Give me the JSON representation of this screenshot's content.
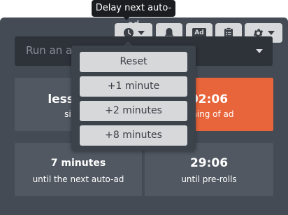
{
  "tooltip": {
    "text": "Delay next auto-ad"
  },
  "toolbar": {
    "buttons": [
      {
        "icon": "clock-icon",
        "has_caret": true
      },
      {
        "icon": "bell-icon"
      },
      {
        "icon": "ad-icon",
        "label": "Ad"
      },
      {
        "icon": "clipboard-icon"
      },
      {
        "icon": "gear-icon",
        "has_caret": true
      }
    ]
  },
  "select": {
    "placeholder": "Run an ad"
  },
  "menu": {
    "items": [
      {
        "label": "Reset"
      },
      {
        "label": "+1 minute"
      },
      {
        "label": "+2 minutes"
      },
      {
        "label": "+8 minutes"
      }
    ]
  },
  "stats": {
    "since_last": {
      "value": "less than",
      "label": "since t"
    },
    "remaining": {
      "value": "02:06",
      "label": "aining of ad"
    },
    "next_auto_ad": {
      "value": "7 minutes",
      "label": "until the next auto-ad"
    },
    "pre_rolls": {
      "value": "29:06",
      "label": "until pre-rolls"
    }
  },
  "colors": {
    "panel": "#444b55",
    "card": "#515862",
    "accent": "#e8643a",
    "button": "#d6d8da"
  }
}
